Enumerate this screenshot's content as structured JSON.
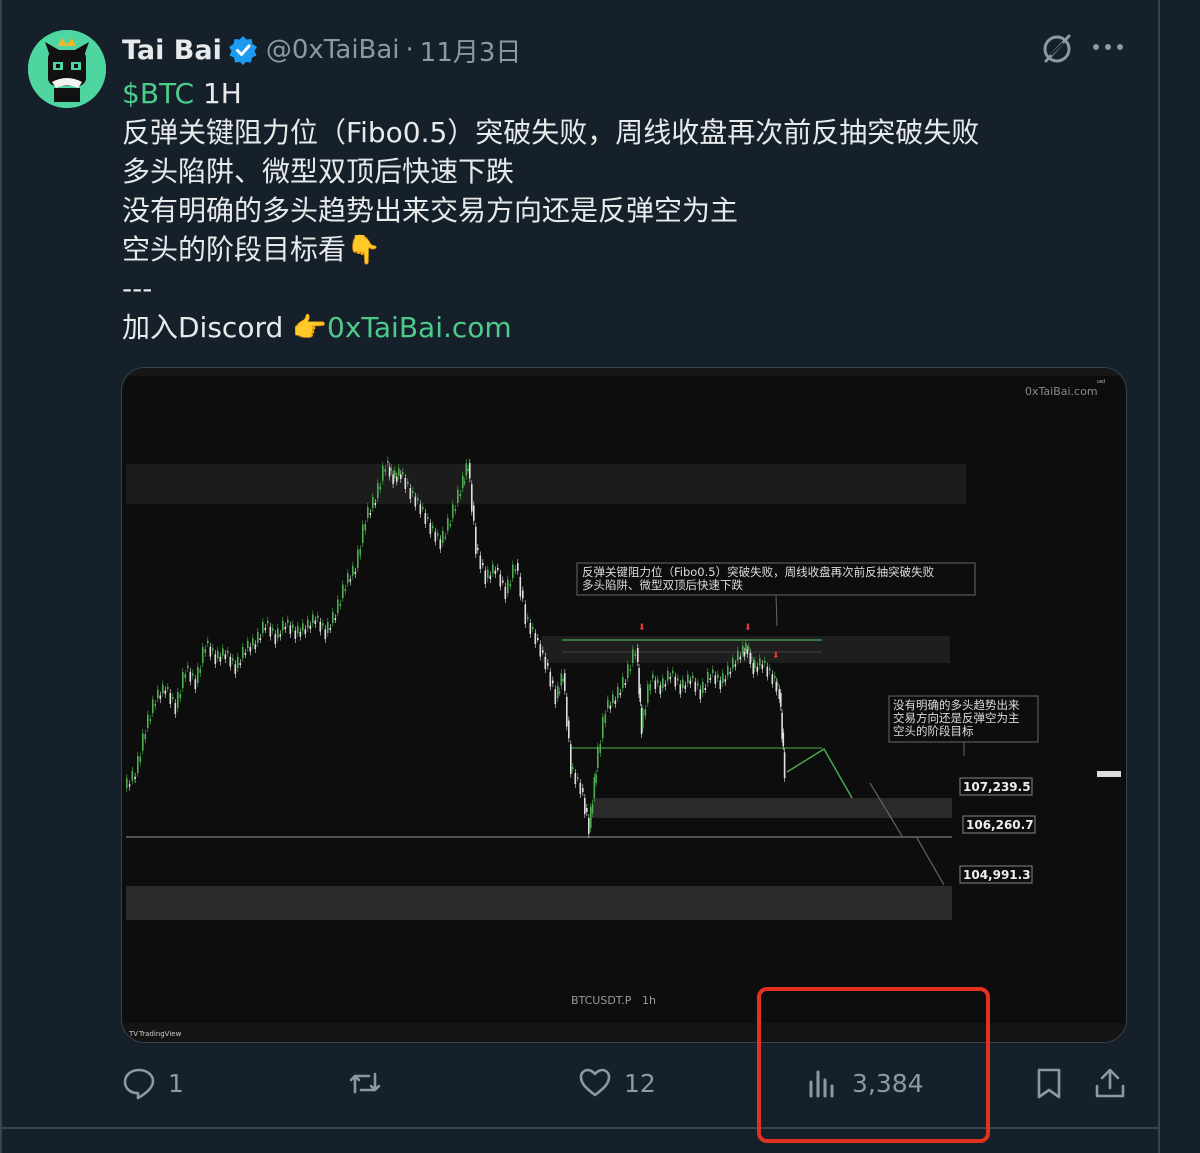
{
  "author": {
    "name": "Tai Bai",
    "handle": "@0xTaiBai",
    "separator": "·",
    "date": "11月3日",
    "avatar_icon": "cat-avatar-icon",
    "verified_color": "#1d9bf0"
  },
  "tweet": {
    "cashtag": "$BTC",
    "timeframe": "1H",
    "line2": "反弹关键阻力位（Fibo0.5）突破失败，周线收盘再次前反抽突破失败",
    "line3": "多头陷阱、微型双顶后快速下跌",
    "line4": "没有明确的多头趋势出来交易方向还是反弹空为主",
    "line5": "空头的阶段目标看",
    "line5_emoji": "👇",
    "line6": "---",
    "line7_prefix": "加入Discord ",
    "line7_emoji": "👉",
    "link": "0xTaiBai.com"
  },
  "chart": {
    "watermark": "0xTaiBai.com",
    "symbol_label": "BTCUSDT.P",
    "interval_label": "1h",
    "brand": "TradingView",
    "annotation1_line1": "反弹关键阻力位（Fibo0.5）突破失败，周线收盘再次前反抽突破失败",
    "annotation1_line2": "多头陷阱、微型双顶后快速下跌",
    "annotation2_line1": "没有明确的多头趋势出来",
    "annotation2_line2": "交易方向还是反弹空为主",
    "annotation2_line3": "空头的阶段目标",
    "target1": "107,239.5",
    "target2": "106,260.7",
    "target3": "104,991.3",
    "bull_color": "#4caf50",
    "bear_color": "#e0e0e0"
  },
  "actions": {
    "reply_count": "1",
    "retweet_count": "",
    "like_count": "12",
    "view_count": "3,384",
    "highlight_color": "#e0321e"
  }
}
